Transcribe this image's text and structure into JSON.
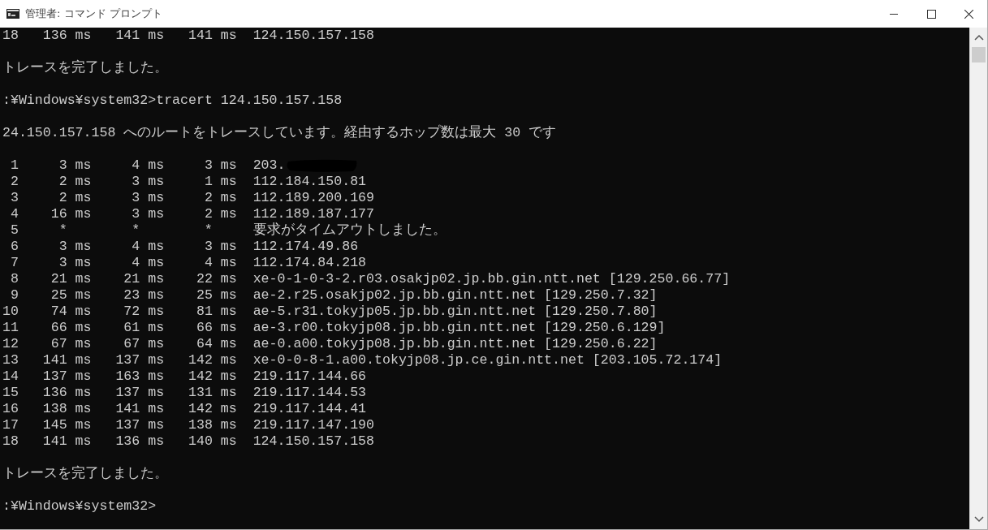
{
  "window": {
    "title": "管理者: コマンド プロンプト"
  },
  "console": {
    "lines": [
      {
        "kind": "hop",
        "hop": "18",
        "rtt": [
          {
            "value": "136",
            "unit": "ms"
          },
          {
            "value": "141",
            "unit": "ms"
          },
          {
            "value": "141",
            "unit": "ms"
          }
        ],
        "host": "124.150.157.158",
        "redacted": false
      },
      {
        "kind": "blank"
      },
      {
        "kind": "text",
        "text": "トレースを完了しました。"
      },
      {
        "kind": "blank"
      },
      {
        "kind": "text",
        "text": ":¥Windows¥system32>tracert 124.150.157.158"
      },
      {
        "kind": "blank"
      },
      {
        "kind": "text",
        "text": "24.150.157.158 へのルートをトレースしています。経由するホップ数は最大 30 です"
      },
      {
        "kind": "blank"
      },
      {
        "kind": "hop",
        "hop": "1",
        "rtt": [
          {
            "value": "3",
            "unit": "ms"
          },
          {
            "value": "4",
            "unit": "ms"
          },
          {
            "value": "3",
            "unit": "ms"
          }
        ],
        "host": "203.",
        "redacted": true
      },
      {
        "kind": "hop",
        "hop": "2",
        "rtt": [
          {
            "value": "2",
            "unit": "ms"
          },
          {
            "value": "3",
            "unit": "ms"
          },
          {
            "value": "1",
            "unit": "ms"
          }
        ],
        "host": "112.184.150.81",
        "redacted": false
      },
      {
        "kind": "hop",
        "hop": "3",
        "rtt": [
          {
            "value": "2",
            "unit": "ms"
          },
          {
            "value": "3",
            "unit": "ms"
          },
          {
            "value": "2",
            "unit": "ms"
          }
        ],
        "host": "112.189.200.169",
        "redacted": false
      },
      {
        "kind": "hop",
        "hop": "4",
        "rtt": [
          {
            "value": "16",
            "unit": "ms"
          },
          {
            "value": "3",
            "unit": "ms"
          },
          {
            "value": "2",
            "unit": "ms"
          }
        ],
        "host": "112.189.187.177",
        "redacted": false
      },
      {
        "kind": "hop",
        "hop": "5",
        "rtt": [
          {
            "value": "*"
          },
          {
            "value": "*"
          },
          {
            "value": "*"
          }
        ],
        "host": "要求がタイムアウトしました。",
        "redacted": false
      },
      {
        "kind": "hop",
        "hop": "6",
        "rtt": [
          {
            "value": "3",
            "unit": "ms"
          },
          {
            "value": "4",
            "unit": "ms"
          },
          {
            "value": "3",
            "unit": "ms"
          }
        ],
        "host": "112.174.49.86",
        "redacted": false
      },
      {
        "kind": "hop",
        "hop": "7",
        "rtt": [
          {
            "value": "3",
            "unit": "ms"
          },
          {
            "value": "4",
            "unit": "ms"
          },
          {
            "value": "4",
            "unit": "ms"
          }
        ],
        "host": "112.174.84.218",
        "redacted": false
      },
      {
        "kind": "hop",
        "hop": "8",
        "rtt": [
          {
            "value": "21",
            "unit": "ms"
          },
          {
            "value": "21",
            "unit": "ms"
          },
          {
            "value": "22",
            "unit": "ms"
          }
        ],
        "host": "xe-0-1-0-3-2.r03.osakjp02.jp.bb.gin.ntt.net [129.250.66.77]",
        "redacted": false
      },
      {
        "kind": "hop",
        "hop": "9",
        "rtt": [
          {
            "value": "25",
            "unit": "ms"
          },
          {
            "value": "23",
            "unit": "ms"
          },
          {
            "value": "25",
            "unit": "ms"
          }
        ],
        "host": "ae-2.r25.osakjp02.jp.bb.gin.ntt.net [129.250.7.32]",
        "redacted": false
      },
      {
        "kind": "hop",
        "hop": "10",
        "rtt": [
          {
            "value": "74",
            "unit": "ms"
          },
          {
            "value": "72",
            "unit": "ms"
          },
          {
            "value": "81",
            "unit": "ms"
          }
        ],
        "host": "ae-5.r31.tokyjp05.jp.bb.gin.ntt.net [129.250.7.80]",
        "redacted": false
      },
      {
        "kind": "hop",
        "hop": "11",
        "rtt": [
          {
            "value": "66",
            "unit": "ms"
          },
          {
            "value": "61",
            "unit": "ms"
          },
          {
            "value": "66",
            "unit": "ms"
          }
        ],
        "host": "ae-3.r00.tokyjp08.jp.bb.gin.ntt.net [129.250.6.129]",
        "redacted": false
      },
      {
        "kind": "hop",
        "hop": "12",
        "rtt": [
          {
            "value": "67",
            "unit": "ms"
          },
          {
            "value": "67",
            "unit": "ms"
          },
          {
            "value": "64",
            "unit": "ms"
          }
        ],
        "host": "ae-0.a00.tokyjp08.jp.bb.gin.ntt.net [129.250.6.22]",
        "redacted": false
      },
      {
        "kind": "hop",
        "hop": "13",
        "rtt": [
          {
            "value": "141",
            "unit": "ms"
          },
          {
            "value": "137",
            "unit": "ms"
          },
          {
            "value": "142",
            "unit": "ms"
          }
        ],
        "host": "xe-0-0-8-1.a00.tokyjp08.jp.ce.gin.ntt.net [203.105.72.174]",
        "redacted": false
      },
      {
        "kind": "hop",
        "hop": "14",
        "rtt": [
          {
            "value": "137",
            "unit": "ms"
          },
          {
            "value": "163",
            "unit": "ms"
          },
          {
            "value": "142",
            "unit": "ms"
          }
        ],
        "host": "219.117.144.66",
        "redacted": false
      },
      {
        "kind": "hop",
        "hop": "15",
        "rtt": [
          {
            "value": "136",
            "unit": "ms"
          },
          {
            "value": "137",
            "unit": "ms"
          },
          {
            "value": "131",
            "unit": "ms"
          }
        ],
        "host": "219.117.144.53",
        "redacted": false
      },
      {
        "kind": "hop",
        "hop": "16",
        "rtt": [
          {
            "value": "138",
            "unit": "ms"
          },
          {
            "value": "141",
            "unit": "ms"
          },
          {
            "value": "142",
            "unit": "ms"
          }
        ],
        "host": "219.117.144.41",
        "redacted": false
      },
      {
        "kind": "hop",
        "hop": "17",
        "rtt": [
          {
            "value": "145",
            "unit": "ms"
          },
          {
            "value": "137",
            "unit": "ms"
          },
          {
            "value": "138",
            "unit": "ms"
          }
        ],
        "host": "219.117.147.190",
        "redacted": false
      },
      {
        "kind": "hop",
        "hop": "18",
        "rtt": [
          {
            "value": "141",
            "unit": "ms"
          },
          {
            "value": "136",
            "unit": "ms"
          },
          {
            "value": "140",
            "unit": "ms"
          }
        ],
        "host": "124.150.157.158",
        "redacted": false
      },
      {
        "kind": "blank"
      },
      {
        "kind": "text",
        "text": "トレースを完了しました。"
      },
      {
        "kind": "blank"
      },
      {
        "kind": "text",
        "text": ":¥Windows¥system32>"
      }
    ]
  }
}
